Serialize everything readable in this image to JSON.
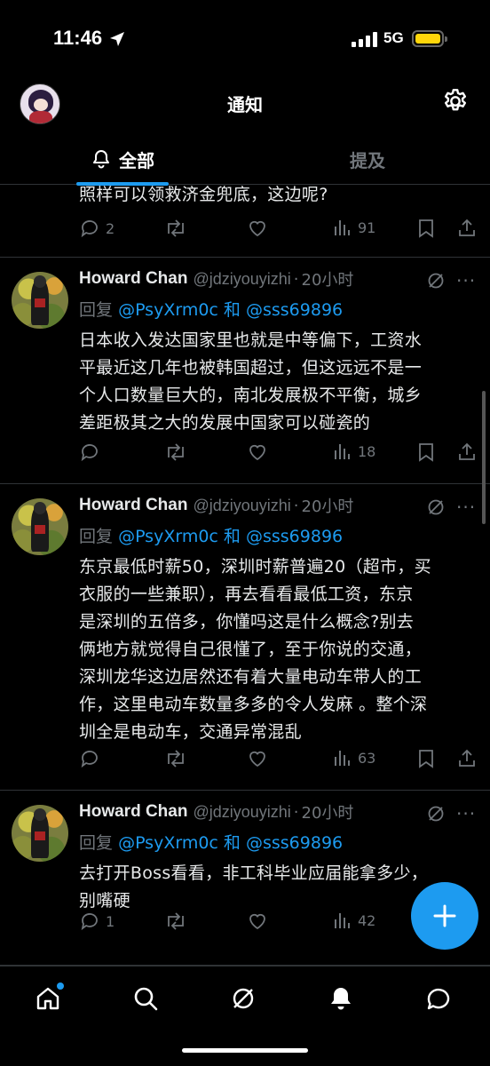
{
  "status_bar": {
    "time": "11:46",
    "network": "5G",
    "battery_color": "#ffd60a"
  },
  "header": {
    "title": "通知",
    "settings_icon": "gear-icon"
  },
  "tabs": [
    {
      "label": "全部",
      "icon": "bell-icon",
      "active": true
    },
    {
      "label": "提及",
      "active": false
    }
  ],
  "posts": [
    {
      "text_lines": [
        "照样可以领救济金兜底，这边呢?"
      ],
      "stats": {
        "replies": "2",
        "retweets": "",
        "likes": "",
        "views": "91"
      }
    },
    {
      "author": "Howard Chan",
      "handle": "@jdziyouyizhi",
      "time": "20小时",
      "reply_prefix": "回复",
      "reply_mention_1": "@PsyXrm0c",
      "reply_and": "和",
      "reply_mention_2": "@sss69896",
      "text_lines": [
        "日本收入发达国家里也就是中等偏下，工资水",
        "平最近这几年也被韩国超过，但这远远不是一",
        "个人口数量巨大的，南北发展极不平衡，城乡",
        "差距极其之大的发展中国家可以碰瓷的"
      ],
      "stats": {
        "replies": "",
        "retweets": "",
        "likes": "",
        "views": "18"
      }
    },
    {
      "author": "Howard Chan",
      "handle": "@jdziyouyizhi",
      "time": "20小时",
      "reply_prefix": "回复",
      "reply_mention_1": "@PsyXrm0c",
      "reply_and": "和",
      "reply_mention_2": "@sss69896",
      "text_lines": [
        "东京最低时薪50，深圳时薪普遍20（超市，买",
        "衣服的一些兼职），再去看看最低工资，东京",
        "是深圳的五倍多，你懂吗这是什么概念?别去",
        "俩地方就觉得自己很懂了，至于你说的交通，",
        "深圳龙华这边居然还有着大量电动车带人的工",
        "作，这里电动车数量多多的令人发麻 。整个深",
        "圳全是电动车，交通异常混乱"
      ],
      "stats": {
        "replies": "",
        "retweets": "",
        "likes": "",
        "views": "63"
      }
    },
    {
      "author": "Howard Chan",
      "handle": "@jdziyouyizhi",
      "time": "20小时",
      "reply_prefix": "回复",
      "reply_mention_1": "@PsyXrm0c",
      "reply_and": "和",
      "reply_mention_2": "@sss69896",
      "text_lines": [
        "去打开Boss看看，非工科毕业应届能拿多少，",
        "别嘴硬"
      ],
      "stats": {
        "replies": "1",
        "retweets": "",
        "likes": "",
        "views": "42"
      }
    }
  ],
  "fab": {
    "icon": "plus-icon"
  },
  "bottom_nav": [
    {
      "name": "home",
      "icon": "home-icon",
      "has_dot": true
    },
    {
      "name": "search",
      "icon": "search-icon"
    },
    {
      "name": "grok",
      "icon": "grok-icon"
    },
    {
      "name": "notifications",
      "icon": "bell-icon"
    },
    {
      "name": "messages",
      "icon": "message-icon"
    }
  ],
  "colors": {
    "accent": "#1d9bf0",
    "muted": "#71767b",
    "text": "#e7e9ea",
    "divider": "#2f3336"
  }
}
